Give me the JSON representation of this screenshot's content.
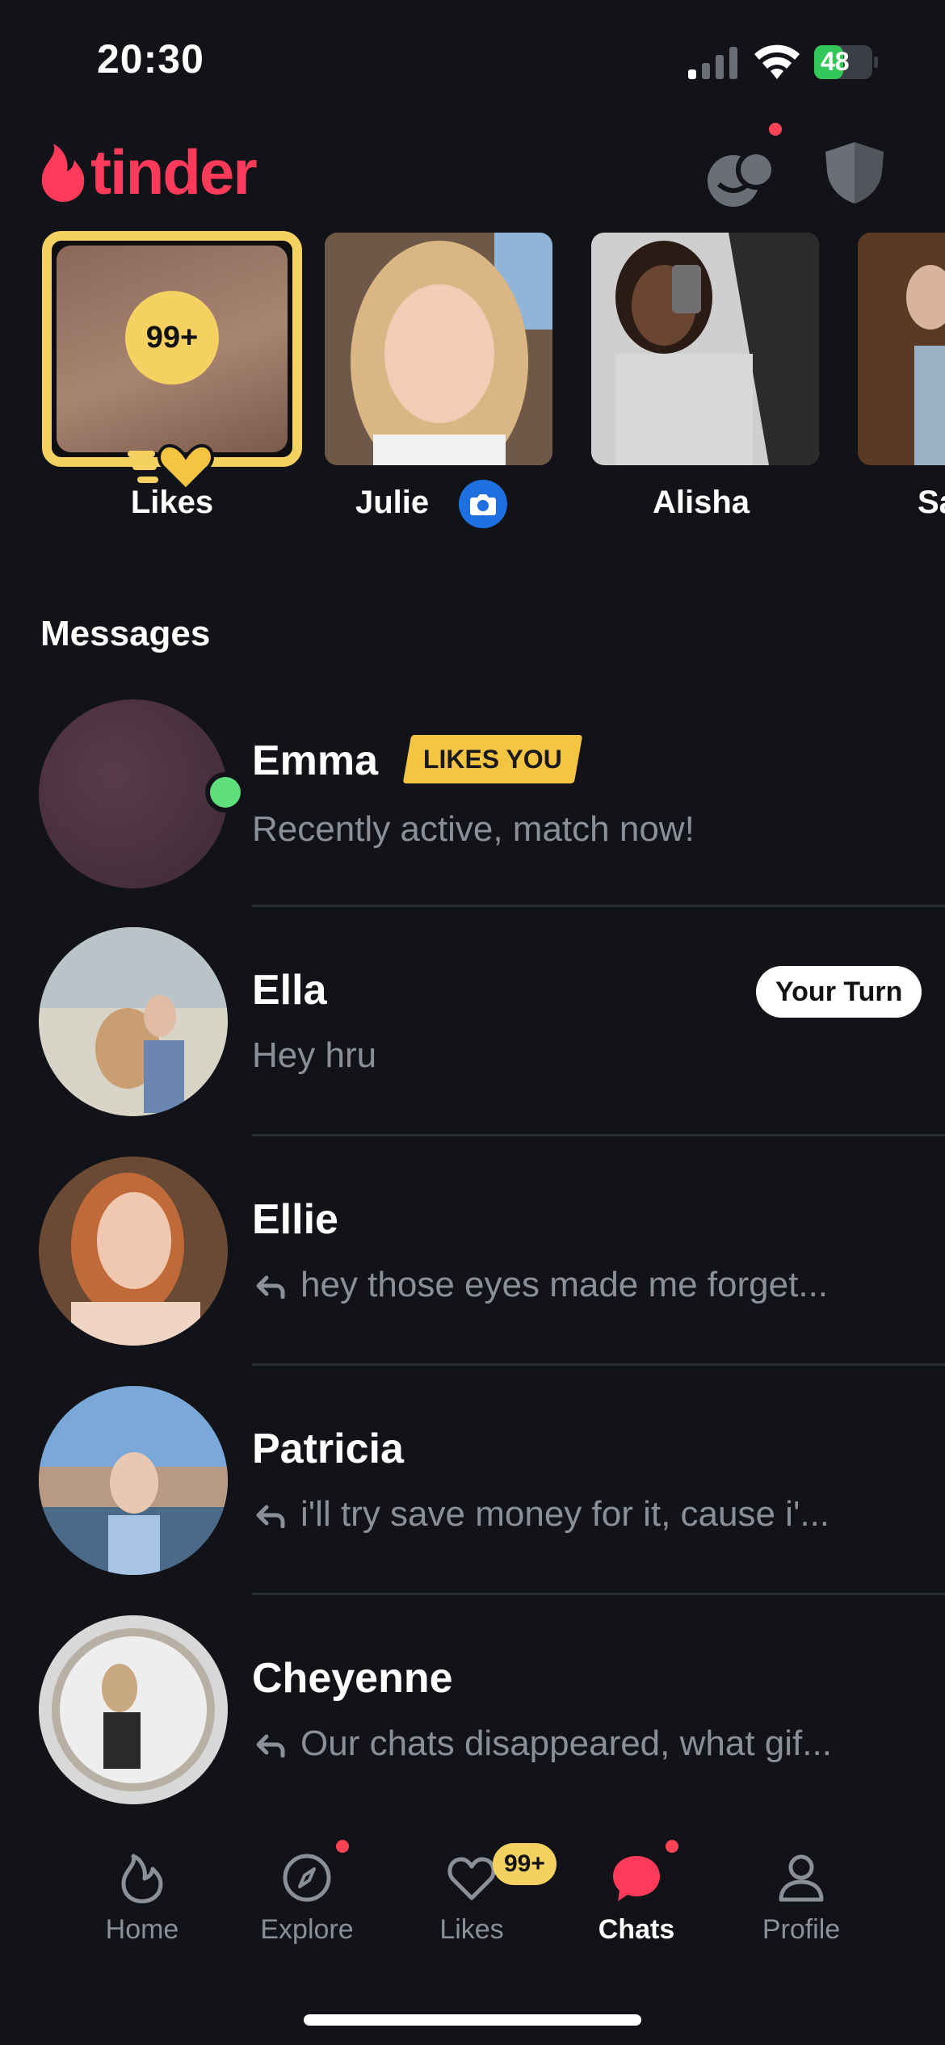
{
  "status_bar": {
    "time": "20:30",
    "battery": "48"
  },
  "app": {
    "logo_text": "tinder",
    "brand_color": "#fd3a5a"
  },
  "new_matches": {
    "likes": {
      "count": "99+",
      "label": "Likes"
    },
    "matches": [
      {
        "name": "Julie",
        "has_camera_badge": true
      },
      {
        "name": "Alisha"
      },
      {
        "name": "Sa"
      }
    ]
  },
  "messages": {
    "title": "Messages",
    "rows": [
      {
        "name": "Emma",
        "badge": "LIKES YOU",
        "preview": "Recently active, match now!",
        "online": true
      },
      {
        "name": "Ella",
        "preview": "Hey hru",
        "pill": "Your Turn"
      },
      {
        "name": "Ellie",
        "preview": "hey those eyes made me forget...",
        "replied": true
      },
      {
        "name": "Patricia",
        "preview": "i'll try save money for it, cause i'...",
        "replied": true
      },
      {
        "name": "Cheyenne",
        "preview": "Our chats disappeared, what gif...",
        "replied": true
      }
    ]
  },
  "tab_bar": {
    "tabs": [
      {
        "label": "Home",
        "icon": "flame-outline-icon"
      },
      {
        "label": "Explore",
        "icon": "compass-icon"
      },
      {
        "label": "Likes",
        "icon": "heart-icon",
        "badge": "99+"
      },
      {
        "label": "Chats",
        "icon": "chat-bubble-icon",
        "active": true
      },
      {
        "label": "Profile",
        "icon": "person-icon"
      }
    ]
  },
  "colors": {
    "accent_yellow": "#f5d162",
    "online_green": "#5fe07c",
    "notify_red": "#ff4458"
  }
}
